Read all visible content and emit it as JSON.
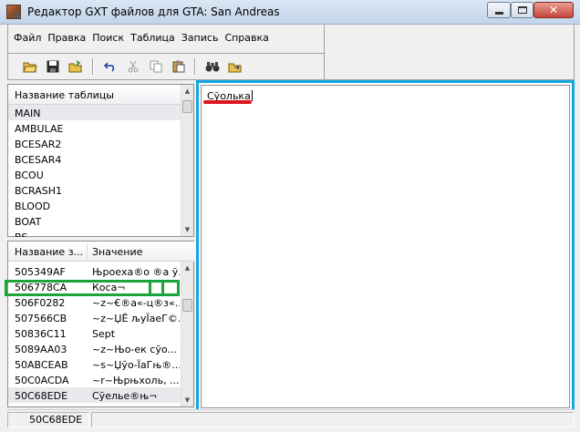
{
  "window": {
    "title": "Редактор GXT файлов для GTA: San Andreas",
    "controls": {
      "close_glyph": "✕"
    }
  },
  "menu": {
    "items": [
      "Файл",
      "Правка",
      "Поиск",
      "Таблица",
      "Запись",
      "Справка"
    ]
  },
  "toolbar": {
    "buttons": [
      "open-folder-icon",
      "save-icon",
      "open-file-icon",
      "undo-icon",
      "cut-icon",
      "copy-icon",
      "paste-icon",
      "find-icon",
      "find-next-icon"
    ]
  },
  "tables": {
    "header": "Название таблицы",
    "rows": [
      "MAIN",
      "AMBULAE",
      "BCESAR2",
      "BCESAR4",
      "BCOU",
      "BCRASH1",
      "BLOOD",
      "BOAT",
      "BS"
    ],
    "selected_index": 0
  },
  "entries": {
    "columns": [
      "Название з...",
      "Значение"
    ],
    "rows": [
      {
        "key": "505349AF",
        "value": "Њроеха®о ®а ў..."
      },
      {
        "key": "506778CA",
        "value": "Коса¬"
      },
      {
        "key": "506F0282",
        "value": "~z~€®а«-ц®з«..."
      },
      {
        "key": "507566CB",
        "value": "~z~ЏЁ љуЇаеГ©..."
      },
      {
        "key": "50836C11",
        "value": "Sept"
      },
      {
        "key": "5089AA03",
        "value": "~z~Њо-ек сўо..."
      },
      {
        "key": "50ABCEAB",
        "value": "~s~Џўо-ЇаГњ®..."
      },
      {
        "key": "50C0ACDA",
        "value": "~r~Њрњхоль, ..."
      },
      {
        "key": "50C68EDE",
        "value": "Сўелье®њ¬"
      }
    ],
    "selected_index": 8
  },
  "editor": {
    "text": "Сўолька"
  },
  "status": {
    "current_key": "50C68EDE"
  },
  "colors": {
    "highlight_blue": "#12a7e3",
    "highlight_green": "#1aa43a",
    "underline_red": "#e0141e"
  }
}
